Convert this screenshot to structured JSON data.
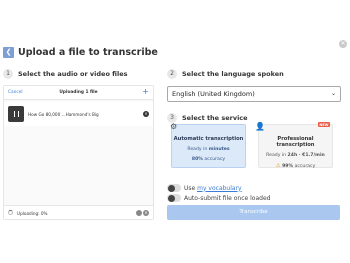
{
  "header": {
    "title": "Upload a file to transcribe",
    "back_icon": "back-arrow-icon",
    "close_icon": "close-icon"
  },
  "steps": [
    {
      "number": "1",
      "label": "Select the audio or video files"
    },
    {
      "number": "2",
      "label": "Select the language spoken"
    },
    {
      "number": "3",
      "label": "Select the service"
    }
  ],
  "upload": {
    "cancel_label": "Cancel",
    "count_label": "Uploading 1 file",
    "add_label": "+",
    "file_name": "How Go 80,000 ...Hammond's Big",
    "remove_label": "×",
    "status": "Uploading: 0%",
    "progress_percent": 0
  },
  "language": {
    "selected": "English (United Kingdom)",
    "chevron_icon": "chevron-down-icon"
  },
  "services": {
    "automatic": {
      "title": "Automatic transcription",
      "ready_prefix": "Ready in ",
      "ready_value": "minutes",
      "accuracy_value": "80%",
      "accuracy_suffix": " accuracy",
      "icon": "gear-icon"
    },
    "professional": {
      "title": "Professional transcription",
      "badge": "NEW",
      "ready_prefix": "Ready in ",
      "ready_value": "24h",
      "price": " · €1.7/min",
      "accuracy_value": "99%",
      "accuracy_suffix": " accuracy",
      "icon": "person-icon"
    }
  },
  "options": {
    "vocabulary_prefix": "Use ",
    "vocabulary_link": "my vocabulary",
    "autosubmit_label": "Auto-submit file once loaded"
  },
  "action": {
    "transcribe_label": "Transcribe"
  },
  "colors": {
    "accent": "#3a7bd5",
    "button_disabled": "#a9c7ef",
    "selected_card": "#dbe9f8",
    "badge": "#e8604c"
  }
}
